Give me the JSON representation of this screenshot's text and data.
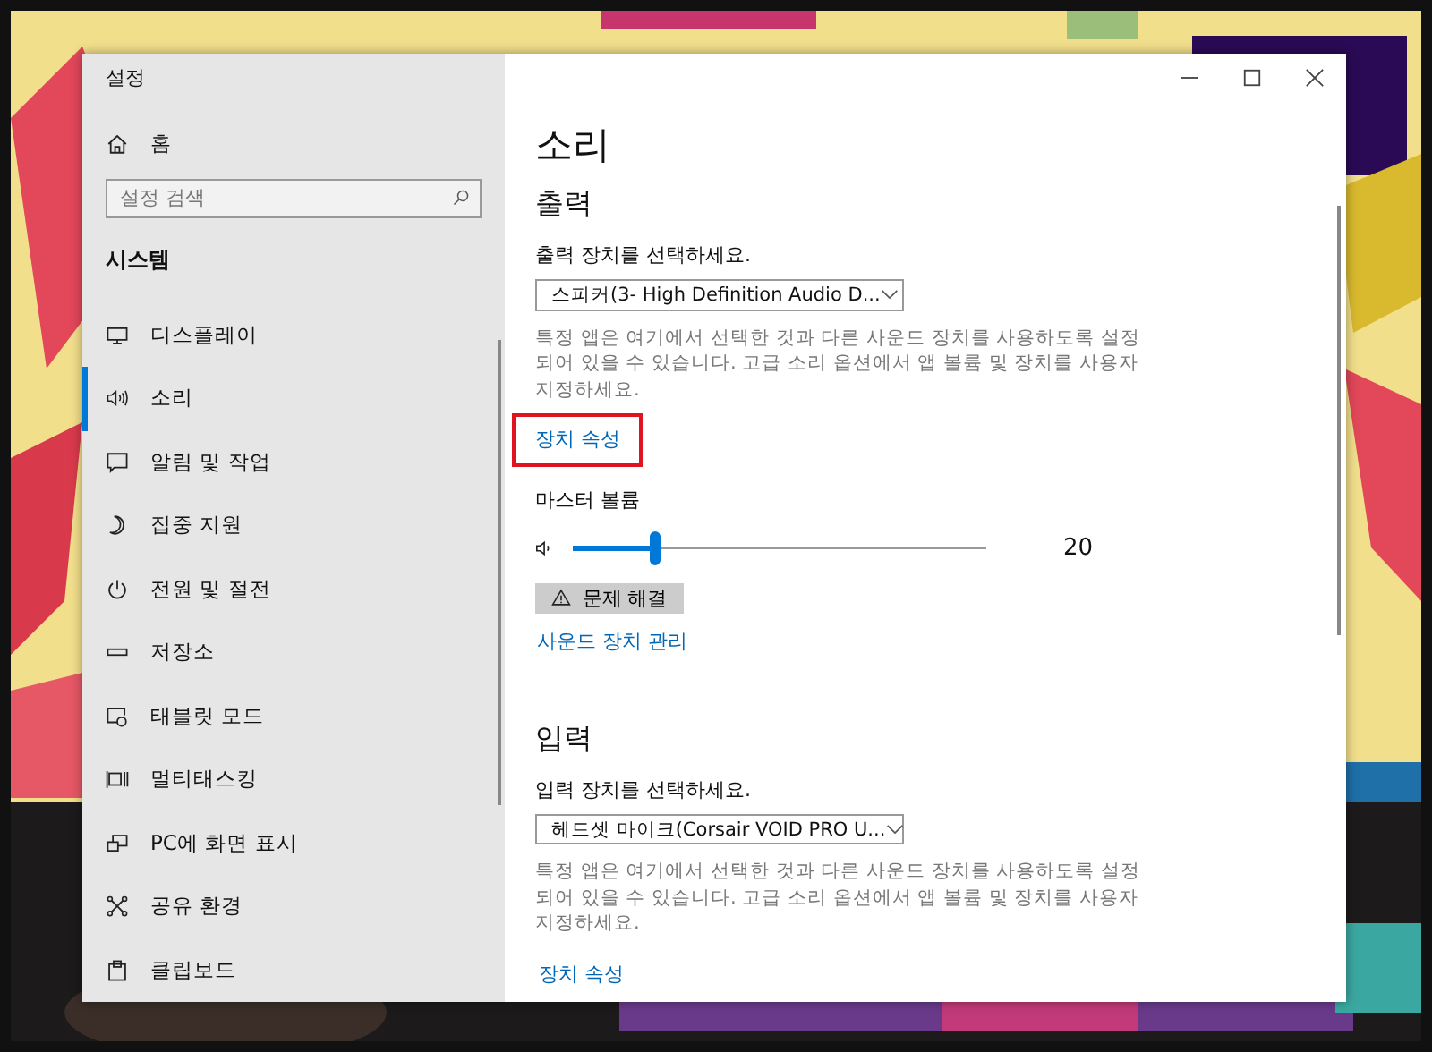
{
  "window": {
    "title": "설정"
  },
  "sidebar": {
    "home": "홈",
    "search": {
      "placeholder": "설정 검색"
    },
    "section": "시스템",
    "items": [
      {
        "label": "디스플레이",
        "selected": false
      },
      {
        "label": "소리",
        "selected": true
      },
      {
        "label": "알림 및 작업",
        "selected": false
      },
      {
        "label": "집중 지원",
        "selected": false
      },
      {
        "label": "전원 및 절전",
        "selected": false
      },
      {
        "label": "저장소",
        "selected": false
      },
      {
        "label": "태블릿 모드",
        "selected": false
      },
      {
        "label": "멀티태스킹",
        "selected": false
      },
      {
        "label": "PC에 화면 표시",
        "selected": false
      },
      {
        "label": "공유 환경",
        "selected": false
      },
      {
        "label": "클립보드",
        "selected": false
      }
    ]
  },
  "page": {
    "title": "소리",
    "output": {
      "heading": "출력",
      "label": "출력 장치를 선택하세요.",
      "device": "스피커(3- High Definition Audio D...",
      "description": "특정 앱은 여기에서 선택한 것과 다른 사운드 장치를 사용하도록 설정되어 있을 수 있습니다. 고급 소리 옵션에서 앱 볼륨 및 장치를 사용자 지정하세요.",
      "link": {
        "label": "장치 속성",
        "highlighted": true
      },
      "volume_label": "마스터 볼륨",
      "volume": {
        "level": 0.2,
        "reading": "20"
      },
      "troubleshoot": "문제 해결",
      "manage_link": "사운드 장치 관리"
    },
    "input": {
      "heading": "입력",
      "label": "입력 장치를 선택하세요.",
      "device": "헤드셋 마이크(Corsair VOID PRO U...",
      "description": "특정 앱은 여기에서 선택한 것과 다른 사운드 장치를 사용하도록 설정되어 있을 수 있습니다. 고급 소리 옵션에서 앱 볼륨 및 장치를 사용자 지정하세요.",
      "link": {
        "label": "장치 속성",
        "highlighted": false
      }
    }
  }
}
